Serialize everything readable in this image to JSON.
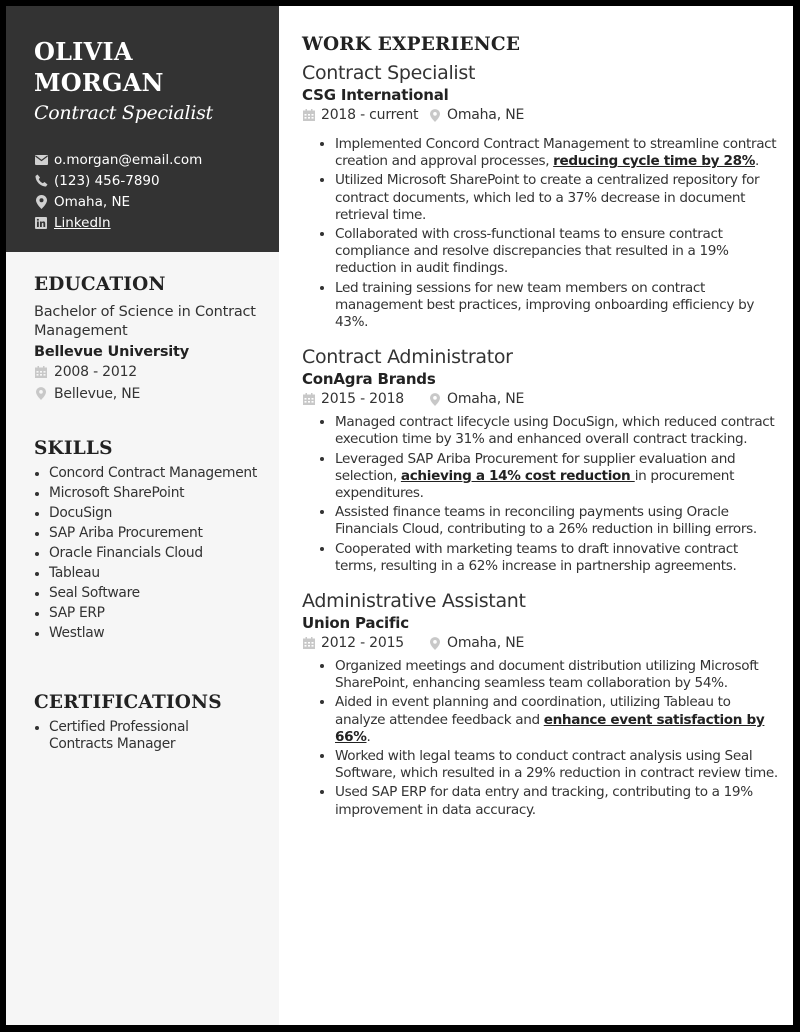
{
  "header": {
    "name_line1": "OLIVIA",
    "name_line2": "MORGAN",
    "headline": "Contract Specialist",
    "contacts": {
      "email": "o.morgan@email.com",
      "phone": "(123) 456-7890",
      "location": "Omaha, NE",
      "linkedin": "LinkedIn"
    },
    "icons": {
      "email": "envelope-icon",
      "phone": "phone-icon",
      "location": "map-pin-icon",
      "linkedin": "linkedin-icon"
    }
  },
  "colors": {
    "header_bg": "#333333",
    "sidebar_bg": "#f6f6f6",
    "page_border": "#000000",
    "icon_grey": "#c4c4c4"
  },
  "education": {
    "title": "EDUCATION",
    "degree": "Bachelor of Science in Contract Management",
    "school": "Bellevue University",
    "dates": "2008 - 2012",
    "location": "Bellevue, NE"
  },
  "skills": {
    "title": "SKILLS",
    "items": [
      "Concord Contract Management",
      "Microsoft SharePoint",
      "DocuSign",
      "SAP Ariba Procurement",
      "Oracle Financials Cloud",
      "Tableau",
      "Seal Software",
      "SAP ERP",
      "Westlaw"
    ]
  },
  "certifications": {
    "title": "CERTIFICATIONS",
    "items": [
      "Certified Professional Contracts Manager"
    ]
  },
  "experience": {
    "title": "WORK EXPERIENCE",
    "jobs": [
      {
        "title": "Contract Specialist",
        "company": "CSG International",
        "dates": "2018 - current",
        "location": "Omaha, NE",
        "bullets": [
          {
            "pre": "Implemented Concord Contract Management to streamline contract creation and approval processes, ",
            "em": "reducing cycle time by 28%",
            "post": "."
          },
          {
            "pre": "Utilized Microsoft SharePoint to create a centralized repository for contract documents, which led to a 37% decrease in document retrieval time.",
            "em": "",
            "post": ""
          },
          {
            "pre": "Collaborated with cross-functional teams to ensure contract compliance and resolve discrepancies that resulted in a 19% reduction in audit findings.",
            "em": "",
            "post": ""
          },
          {
            "pre": " Led training sessions for new team members on contract management best practices, improving onboarding efficiency by 43%.",
            "em": "",
            "post": ""
          }
        ]
      },
      {
        "title": "Contract Administrator",
        "company": "ConAgra Brands",
        "dates": "2015 - 2018",
        "location": "Omaha, NE",
        "bullets": [
          {
            "pre": "Managed contract lifecycle using DocuSign, which reduced contract execution time by 31% and enhanced overall contract tracking.",
            "em": "",
            "post": ""
          },
          {
            "pre": "Leveraged SAP Ariba Procurement for supplier evaluation and selection, ",
            "em": "achieving a 14% cost reduction ",
            "post": "in procurement expenditures."
          },
          {
            "pre": "Assisted finance teams in reconciling payments using Oracle Financials Cloud, contributing to a 26% reduction in billing errors.",
            "em": "",
            "post": ""
          },
          {
            "pre": "Cooperated with marketing teams to draft innovative contract terms, resulting in a 62% increase in partnership agreements.",
            "em": "",
            "post": ""
          }
        ]
      },
      {
        "title": "Administrative Assistant",
        "company": "Union Pacific",
        "dates": "2012 - 2015",
        "location": "Omaha, NE",
        "bullets": [
          {
            "pre": "Organized meetings and document distribution utilizing Microsoft SharePoint, enhancing seamless team collaboration by 54%.",
            "em": "",
            "post": ""
          },
          {
            "pre": " Aided in event planning and coordination, utilizing Tableau to analyze attendee feedback and ",
            "em": "enhance event satisfaction by 66%",
            "post": "."
          },
          {
            "pre": "Worked with legal teams to conduct contract analysis using Seal Software, which resulted in a 29% reduction in contract review time.",
            "em": "",
            "post": ""
          },
          {
            "pre": "Used SAP ERP for data entry and tracking, contributing to a 19% improvement in data accuracy.",
            "em": "",
            "post": ""
          }
        ]
      }
    ]
  }
}
